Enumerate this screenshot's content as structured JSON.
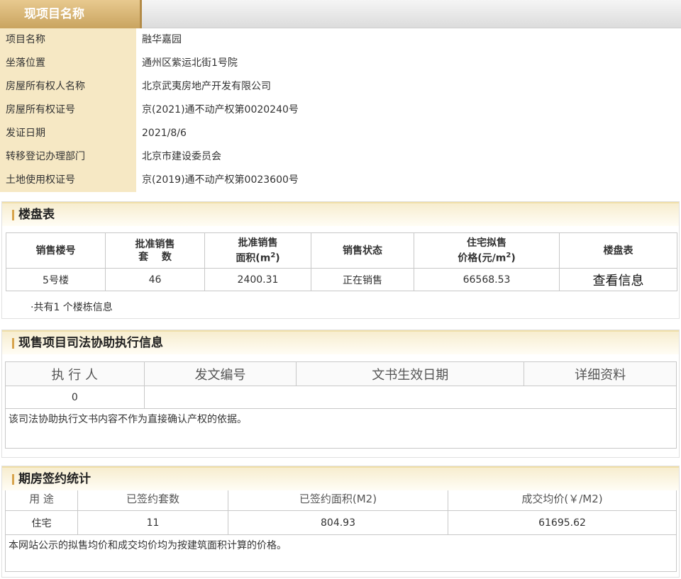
{
  "tab": {
    "title": "现项目名称"
  },
  "info": [
    {
      "label": "项目名称",
      "value": "融华嘉园"
    },
    {
      "label": "坐落位置",
      "value": "通州区紫运北街1号院"
    },
    {
      "label": "房屋所有权人名称",
      "value": "北京武夷房地产开发有限公司"
    },
    {
      "label": "房屋所有权证号",
      "value": "京(2021)通不动产权第0020240号"
    },
    {
      "label": "发证日期",
      "value": "2021/8/6"
    },
    {
      "label": "转移登记办理部门",
      "value": "北京市建设委员会"
    },
    {
      "label": "土地使用权证号",
      "value": "京(2019)通不动产权第0023600号"
    }
  ],
  "building": {
    "title": "楼盘表",
    "headers": {
      "h1": "销售楼号",
      "h2a": "批准销售",
      "h2b": "套　 数",
      "h3a": "批准销售",
      "h3b": "面积(m",
      "h4": "销售状态",
      "h5a": "住宅拟售",
      "h5b": "价格(元/m",
      "h6": "楼盘表",
      "sup": "2",
      "close": ")"
    },
    "row": {
      "c1": "5号楼",
      "c2": "46",
      "c3": "2400.31",
      "c4": "正在销售",
      "c5": "66568.53",
      "c6": "查看信息"
    },
    "note": "·共有1 个楼栋信息"
  },
  "judicial": {
    "title": "现售项目司法协助执行信息",
    "headers": [
      "执 行 人",
      "发文编号",
      "文书生效日期",
      "详细资料"
    ],
    "row": {
      "c1": "0"
    },
    "note": "该司法协助执行文书内容不作为直接确认产权的依据。"
  },
  "contract": {
    "title": "期房签约统计",
    "headers": [
      "用 途",
      "已签约套数",
      "已签约面积(M2)",
      "成交均价(￥/M2)"
    ],
    "row": {
      "c1": "住宅",
      "c2": "11",
      "c3": "804.93",
      "c4": "61695.62"
    },
    "note": "本网站公示的拟售均价和成交均价均为按建筑面积计算的价格。"
  }
}
